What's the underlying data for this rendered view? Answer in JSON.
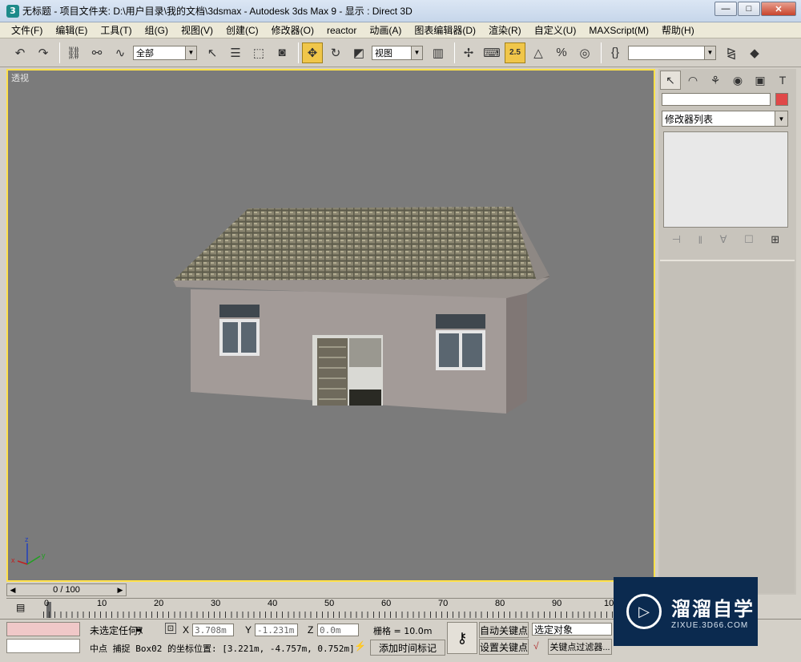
{
  "window": {
    "title": "无标题    - 项目文件夹: D:\\用户目录\\我的文档\\3dsmax     - Autodesk 3ds Max 9     - 显示 : Direct 3D",
    "app_icon": "3",
    "minimize": "—",
    "maximize": "□",
    "close": "✕"
  },
  "menu": [
    "文件(F)",
    "编辑(E)",
    "工具(T)",
    "组(G)",
    "视图(V)",
    "创建(C)",
    "修改器(O)",
    "reactor",
    "动画(A)",
    "图表编辑器(D)",
    "渲染(R)",
    "自定义(U)",
    "MAXScript(M)",
    "帮助(H)"
  ],
  "toolbar": {
    "selection_filter": "全部",
    "ref_coord": "视图",
    "snap_value": "2.5",
    "named_selection": ""
  },
  "viewport": {
    "label": "透视",
    "axis_labels": {
      "z": "z",
      "x": "x",
      "y": "y"
    }
  },
  "command_panel": {
    "modifier_list": "修改器列表",
    "object_color": "#e04848"
  },
  "timeline": {
    "frame_display": "0 / 100",
    "ticks": [
      "0",
      "10",
      "20",
      "30",
      "40",
      "50",
      "60",
      "70",
      "80",
      "90",
      "100"
    ]
  },
  "status": {
    "selection": "未选定任何对",
    "x_label": "X",
    "x_value": "3.708m",
    "y_label": "Y",
    "y_value": "-1.231m",
    "z_label": "Z",
    "z_value": "0.0m",
    "grid": "栅格 = 10.0m",
    "auto_key": "自动关键点",
    "set_key": "设置关键点",
    "selected_filter": "选定对象",
    "key_filters": "关键点过滤器...",
    "add_time_tag": "添加时间标记",
    "prompt": "中点  捕捉  Box02  的坐标位置:  [3.221m, -4.757m, 0.752m]"
  },
  "watermark": {
    "title": "溜溜自学",
    "url": "ZIXUE.3D66.COM"
  }
}
